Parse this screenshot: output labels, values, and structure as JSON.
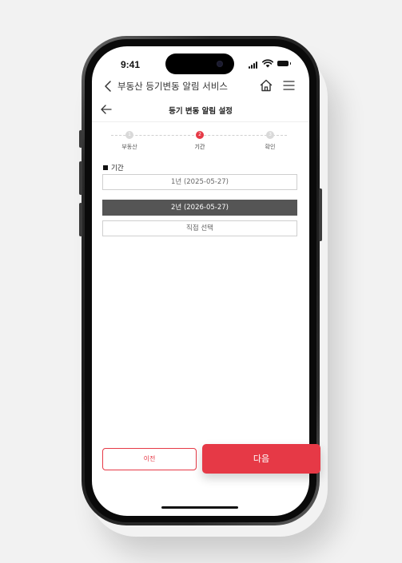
{
  "status_bar": {
    "time": "9:41"
  },
  "browser": {
    "title": "부동산 등기변동 알림 서비스"
  },
  "header": {
    "title": "등기 변동 알림 설정"
  },
  "stepper": {
    "steps": [
      {
        "number": "1",
        "label": "부동산"
      },
      {
        "number": "2",
        "label": "기간"
      },
      {
        "number": "3",
        "label": "확인"
      }
    ],
    "active_step": 2
  },
  "section": {
    "label": "기간"
  },
  "options": [
    {
      "label": "1년 (2025-05-27)",
      "selected": false
    },
    {
      "label": "2년 (2026-05-27)",
      "selected": true
    },
    {
      "label": "직접 선택",
      "selected": false
    }
  ],
  "buttons": {
    "prev_label": "이전",
    "next_label": "다음"
  },
  "colors": {
    "accent": "#e63946",
    "selected_bg": "#555555"
  }
}
